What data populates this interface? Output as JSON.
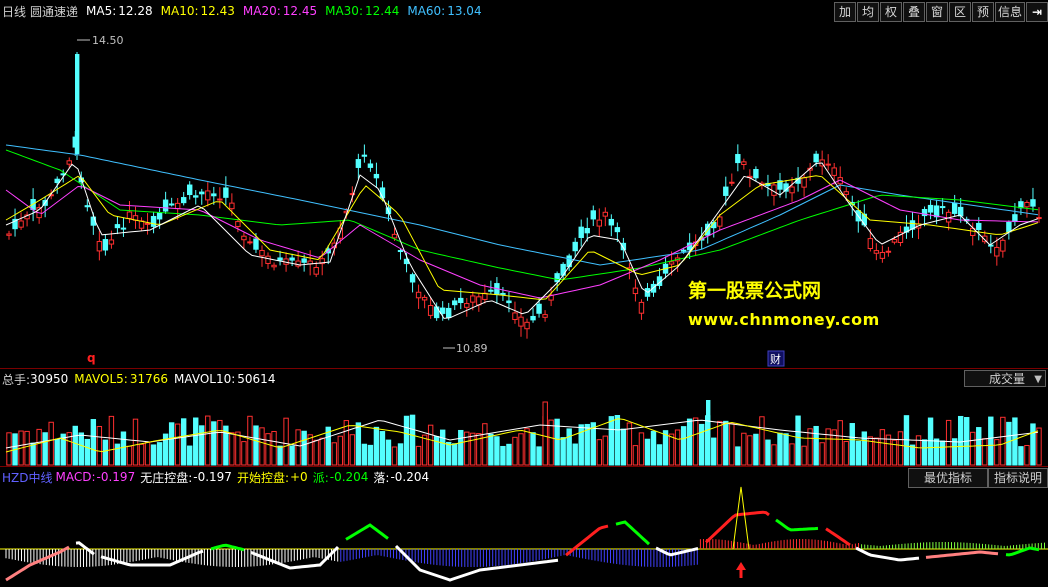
{
  "header": {
    "period": "日线",
    "stock_name": "圆通速递",
    "ma5": {
      "label": "MA5:",
      "value": "12.28",
      "color": "#ffffff"
    },
    "ma10": {
      "label": "MA10:",
      "value": "12.43",
      "color": "#ffff00"
    },
    "ma20": {
      "label": "MA20:",
      "value": "12.45",
      "color": "#ff40ff"
    },
    "ma30": {
      "label": "MA30:",
      "value": "12.44",
      "color": "#00ff00"
    },
    "ma60": {
      "label": "MA60:",
      "value": "13.04",
      "color": "#40c0ff"
    }
  },
  "toolbar": [
    "加",
    "均",
    "权",
    "叠",
    "窗",
    "区",
    "预",
    "信息"
  ],
  "toolbar_icon": "exit-right-icon",
  "price_chart": {
    "high_label": "14.50",
    "low_label": "10.89",
    "marker_q": "q",
    "marker_cai": "财"
  },
  "watermark": {
    "line1": "第一股票公式网",
    "line2": "www.chnmoney.com"
  },
  "volume": {
    "label": "总手:",
    "value": "30950",
    "mavol5_label": "MAVOL5:",
    "mavol5": "31766",
    "mavol10_label": "MAVOL10:",
    "mavol10": "50614",
    "selector": "成交量"
  },
  "indicator": {
    "name": "HZD中线",
    "macd_label": "MACD:",
    "macd": "-0.197",
    "wz_label": "无庄控盘:",
    "wz": "-0.197",
    "ks_label": "开始控盘:",
    "ks": "+0",
    "pai_label": "派:",
    "pai": "-0.204",
    "luo_label": "落:",
    "luo": "-0.204",
    "btn_best": "最优指标",
    "btn_help": "指标说明"
  },
  "colors": {
    "up": "#ff3030",
    "down": "#54ffff",
    "border": "#7a0000"
  }
}
